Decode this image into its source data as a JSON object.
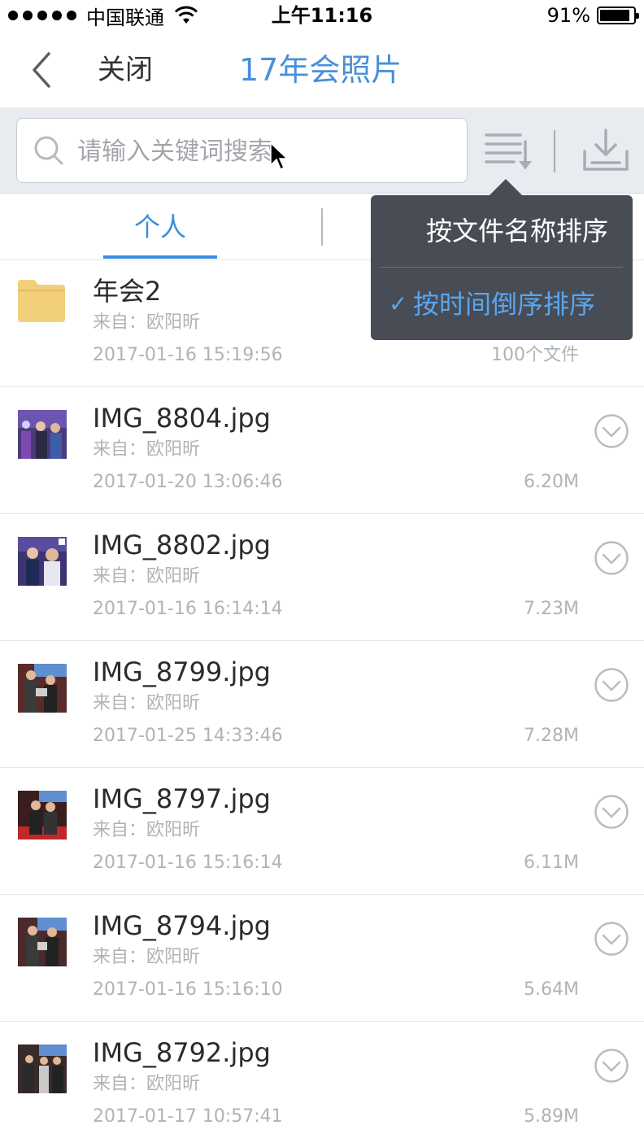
{
  "status_bar": {
    "carrier": "中国联通",
    "time": "上午11:16",
    "battery": "91%",
    "battery_level": 0.91
  },
  "nav": {
    "close_label": "关闭",
    "title": "17年会照片"
  },
  "search": {
    "placeholder": "请输入关键词搜索"
  },
  "tabs": [
    {
      "label": "个人"
    },
    {
      "label": ""
    }
  ],
  "sort_menu": {
    "items": [
      {
        "label": "按文件名称排序",
        "checked": false
      },
      {
        "label": "按时间倒序排序",
        "checked": true
      }
    ],
    "check_glyph": "✓"
  },
  "files": [
    {
      "type": "folder",
      "name": "年会2",
      "from": "来自：欧阳昕",
      "date": "2017-01-16 15:19:56",
      "size": "100个文件"
    },
    {
      "type": "image",
      "name": "IMG_8804.jpg",
      "from": "来自：欧阳昕",
      "date": "2017-01-20 13:06:46",
      "size": "6.20M"
    },
    {
      "type": "image",
      "name": "IMG_8802.jpg",
      "from": "来自：欧阳昕",
      "date": "2017-01-16 16:14:14",
      "size": "7.23M"
    },
    {
      "type": "image",
      "name": "IMG_8799.jpg",
      "from": "来自：欧阳昕",
      "date": "2017-01-25 14:33:46",
      "size": "7.28M"
    },
    {
      "type": "image",
      "name": "IMG_8797.jpg",
      "from": "来自：欧阳昕",
      "date": "2017-01-16 15:16:14",
      "size": "6.11M"
    },
    {
      "type": "image",
      "name": "IMG_8794.jpg",
      "from": "来自：欧阳昕",
      "date": "2017-01-16 15:16:10",
      "size": "5.64M"
    },
    {
      "type": "image",
      "name": "IMG_8792.jpg",
      "from": "来自：欧阳昕",
      "date": "2017-01-17 10:57:41",
      "size": "5.89M"
    }
  ],
  "colors": {
    "accent": "#3b8fe0",
    "title_blue": "#4a90d9",
    "popover_bg": "#474c55",
    "folder": "#f2cf7a",
    "muted_text": "#b0b3b7"
  },
  "icons": {
    "back": "chevron-left-icon",
    "search": "search-icon",
    "sort": "sort-icon",
    "download": "download-icon",
    "folder": "folder-icon",
    "row_action": "chevron-down-circle-icon"
  }
}
